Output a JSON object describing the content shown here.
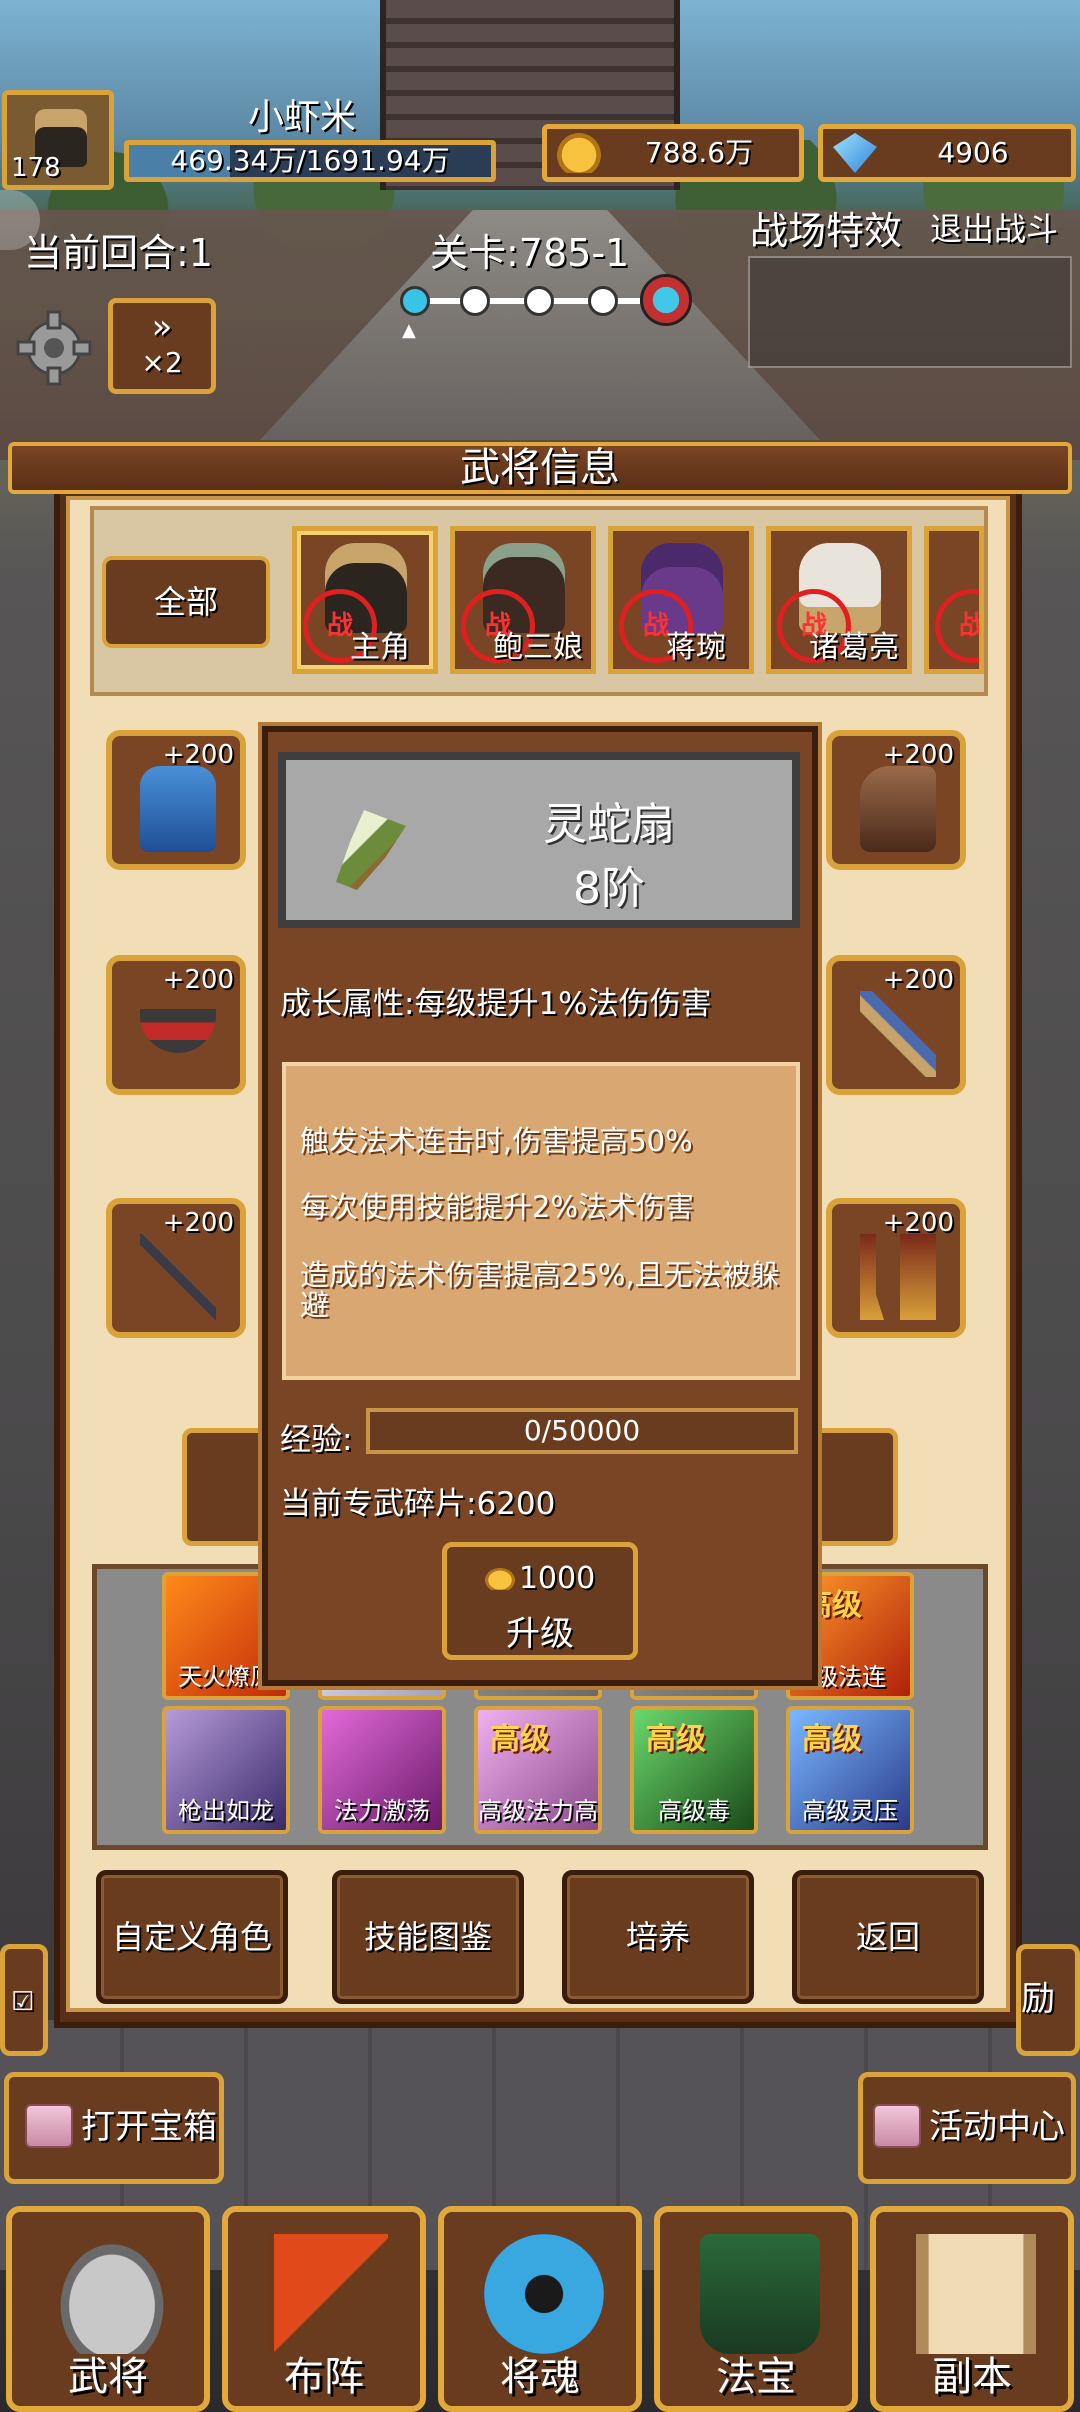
{
  "player": {
    "level": "178",
    "name": "小虾米",
    "hp_text": "469.34万/1691.94万",
    "gold": "788.6万",
    "gems": "4906"
  },
  "battle": {
    "round": "当前回合:1",
    "stage": "关卡:785-1",
    "field_effect": "战场特效",
    "exit": "退出战斗",
    "speed": "×2",
    "wave_progress": 0.0
  },
  "panel": {
    "title": "武将信息",
    "filter_all": "全部",
    "heroes": [
      {
        "name": "主角",
        "badge": "战",
        "selected": true
      },
      {
        "name": "鲍三娘",
        "badge": "战"
      },
      {
        "name": "蒋琬",
        "badge": "战"
      },
      {
        "name": "诸葛亮",
        "badge": "战"
      },
      {
        "name": "",
        "badge": "战"
      }
    ],
    "equipment": [
      {
        "slot": "armor",
        "plus": "+200"
      },
      {
        "slot": "mount",
        "plus": "+200"
      },
      {
        "slot": "belt",
        "plus": "+200"
      },
      {
        "slot": "bow",
        "plus": "+200"
      },
      {
        "slot": "spear",
        "plus": "+200"
      },
      {
        "slot": "boots",
        "plus": "+200"
      }
    ],
    "buttons": {
      "custom": "自定义角色",
      "skill_book": "技能图鉴",
      "train": "培养",
      "back": "返回"
    }
  },
  "weapon": {
    "name": "灵蛇扇",
    "rank": "8阶",
    "growth": "成长属性:每级提升1%法伤伤害",
    "effects": [
      "触发法术连击时,伤害提高50%",
      "每次使用技能提升2%法术伤害",
      "造成的法术伤害提高25%,且无法被躲避"
    ],
    "exp_label": "经验:",
    "exp_value": "0/50000",
    "fragments": "当前专武碎片:6200",
    "upgrade_cost": "1000",
    "upgrade_label": "升级"
  },
  "skills": [
    {
      "tag": "",
      "name": "天火燎原",
      "colors": [
        "#ff8a1a",
        "#c22a0a"
      ]
    },
    {
      "tag": "",
      "name": "",
      "colors": [
        "#f0f0f0",
        "#a0a0c0"
      ]
    },
    {
      "tag": "",
      "name": "",
      "colors": [
        "#9a9a9a",
        "#6a6a6a"
      ]
    },
    {
      "tag": "",
      "name": "",
      "colors": [
        "#9a9a9a",
        "#6a6a6a"
      ]
    },
    {
      "tag": "高级",
      "name": "级法连",
      "colors": [
        "#ff9a2a",
        "#b0200a"
      ]
    },
    {
      "tag": "",
      "name": "枪出如龙",
      "colors": [
        "#b59ad8",
        "#3a2a6a"
      ]
    },
    {
      "tag": "",
      "name": "法力激荡",
      "colors": [
        "#e26ad8",
        "#6a1a6a"
      ]
    },
    {
      "tag": "高级",
      "name": "高级法力高深",
      "colors": [
        "#f0b0f0",
        "#8a4a8a"
      ]
    },
    {
      "tag": "高级",
      "name": "高级毒",
      "colors": [
        "#6ad86a",
        "#1a4a1a"
      ]
    },
    {
      "tag": "高级",
      "name": "高级灵压",
      "colors": [
        "#7ab8ff",
        "#2a3a8a"
      ]
    }
  ],
  "side": {
    "open_chest": "打开宝箱",
    "activity": "活动中心",
    "reward_partial": "励"
  },
  "nav": [
    {
      "label": "武将",
      "icon": "helmet-icon"
    },
    {
      "label": "布阵",
      "icon": "flag-icon"
    },
    {
      "label": "将魂",
      "icon": "soul-icon"
    },
    {
      "label": "法宝",
      "icon": "cauldron-icon"
    },
    {
      "label": "副本",
      "icon": "scroll-icon"
    }
  ]
}
